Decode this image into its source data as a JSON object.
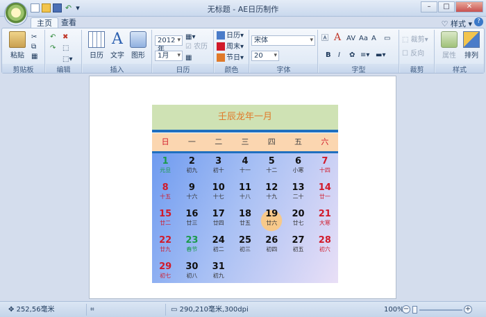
{
  "window": {
    "title": "无标题 - AE日历制作"
  },
  "tabs": [
    {
      "label": "主页",
      "active": true
    },
    {
      "label": "查看",
      "active": false
    }
  ],
  "header_right": {
    "style_label": "样式"
  },
  "ribbon": {
    "clipboard": {
      "paste": "粘贴",
      "group_label": "剪贴板"
    },
    "edit": {
      "group_label": "编辑"
    },
    "insert": {
      "calendar": "日历",
      "text": "文字",
      "shape": "图形",
      "group_label": "插入"
    },
    "calendar": {
      "year_value": "2012年",
      "month_value": "1月",
      "lunar_label": "农历",
      "group_label": "日历"
    },
    "color": {
      "calendar_label": "日历",
      "weekend_label": "周末",
      "holiday_label": "节日",
      "group_label": "颜色"
    },
    "font": {
      "family_value": "宋体",
      "size_value": "20",
      "group_label": "字体"
    },
    "char": {
      "group_label": "字型"
    },
    "crop": {
      "crop_label": "裁剪",
      "reverse_label": "反向",
      "group_label": "裁剪"
    },
    "style": {
      "property_label": "属性",
      "arrange_label": "排列",
      "group_label": "样式"
    }
  },
  "calendar": {
    "title": "壬辰龙年一月",
    "weekdays": [
      {
        "label": "日",
        "red": true
      },
      {
        "label": "一",
        "red": false
      },
      {
        "label": "二",
        "red": false
      },
      {
        "label": "三",
        "red": false
      },
      {
        "label": "四",
        "red": false
      },
      {
        "label": "五",
        "red": false
      },
      {
        "label": "六",
        "red": true
      }
    ],
    "weeks": [
      [
        {
          "d": "1",
          "l": "元旦",
          "c": "green"
        },
        {
          "d": "2",
          "l": "初九"
        },
        {
          "d": "3",
          "l": "初十"
        },
        {
          "d": "4",
          "l": "十一"
        },
        {
          "d": "5",
          "l": "十二"
        },
        {
          "d": "6",
          "l": "小寒"
        },
        {
          "d": "7",
          "l": "十四",
          "c": "red"
        }
      ],
      [
        {
          "d": "8",
          "l": "十五",
          "c": "red"
        },
        {
          "d": "9",
          "l": "十六"
        },
        {
          "d": "10",
          "l": "十七"
        },
        {
          "d": "11",
          "l": "十八"
        },
        {
          "d": "12",
          "l": "十九"
        },
        {
          "d": "13",
          "l": "二十"
        },
        {
          "d": "14",
          "l": "廿一",
          "c": "red"
        }
      ],
      [
        {
          "d": "15",
          "l": "廿二",
          "c": "red"
        },
        {
          "d": "16",
          "l": "廿三"
        },
        {
          "d": "17",
          "l": "廿四"
        },
        {
          "d": "18",
          "l": "廿五"
        },
        {
          "d": "19",
          "l": "廿六",
          "today": true
        },
        {
          "d": "20",
          "l": "廿七"
        },
        {
          "d": "21",
          "l": "大寒",
          "c": "red"
        }
      ],
      [
        {
          "d": "22",
          "l": "廿九",
          "c": "red"
        },
        {
          "d": "23",
          "l": "春节",
          "c": "green"
        },
        {
          "d": "24",
          "l": "初二"
        },
        {
          "d": "25",
          "l": "初三"
        },
        {
          "d": "26",
          "l": "初四"
        },
        {
          "d": "27",
          "l": "初五"
        },
        {
          "d": "28",
          "l": "初六",
          "c": "red"
        }
      ],
      [
        {
          "d": "29",
          "l": "初七",
          "c": "red"
        },
        {
          "d": "30",
          "l": "初八"
        },
        {
          "d": "31",
          "l": "初九"
        }
      ]
    ]
  },
  "status": {
    "cursor_pos": "252,56毫米",
    "page_size": "290,210毫米,300dpi",
    "zoom": "100%"
  },
  "colors": {
    "accent": "#1f6fbf",
    "holiday_red": "#d11a2a",
    "festival_green": "#1a9a4a"
  }
}
